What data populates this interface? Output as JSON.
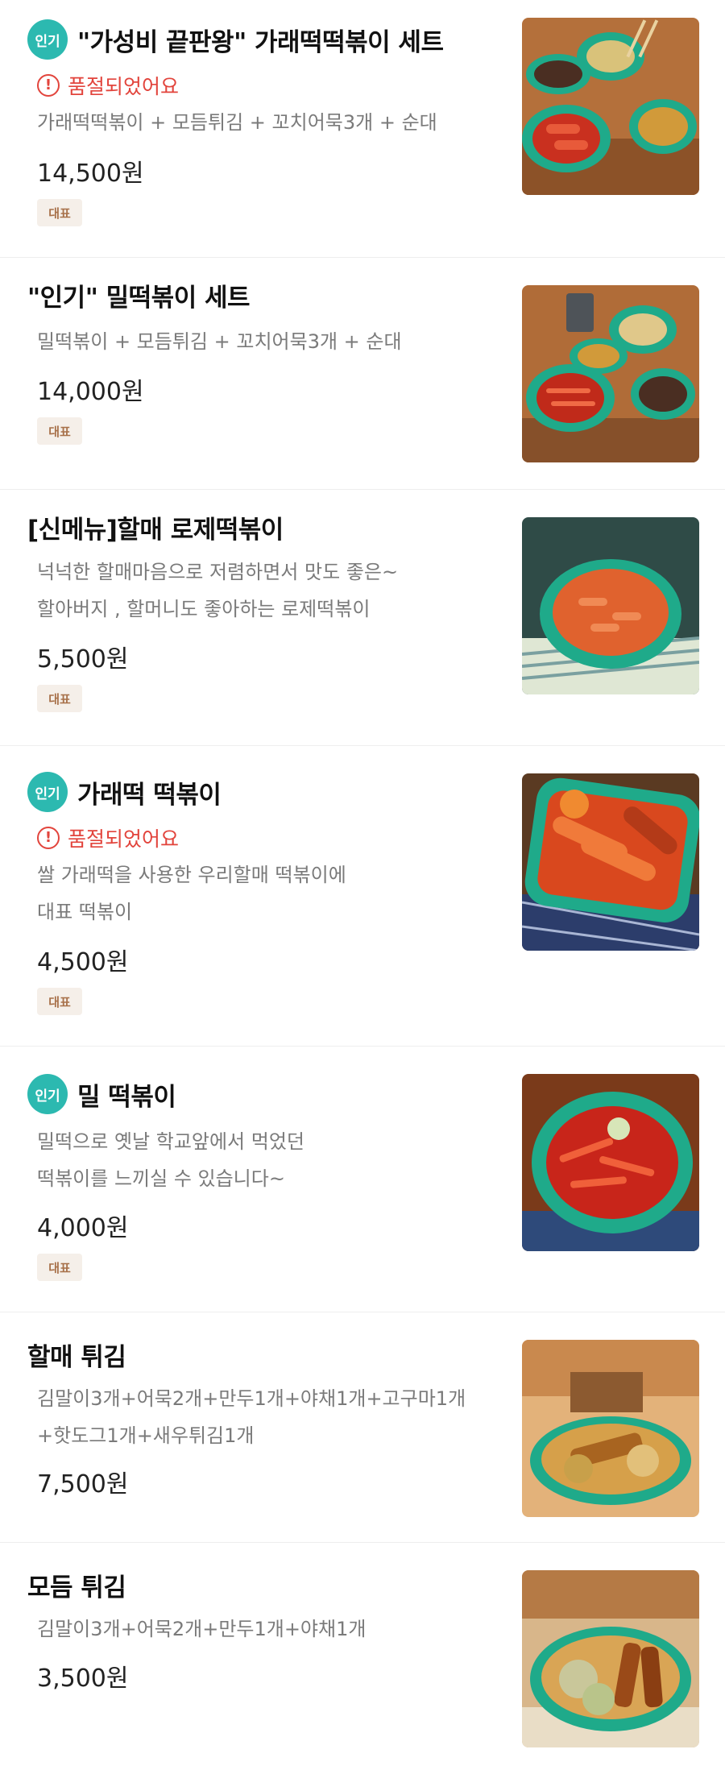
{
  "badges": {
    "popular": "인기",
    "representative": "대표"
  },
  "items": [
    {
      "name": "\"가성비 끝판왕\" 가래떡떡볶이 세트",
      "soldout": "품절되었어요",
      "desc": [
        "가래떡떡볶이 + 모듬튀김 + 꼬치어묵3개 + 순대"
      ],
      "price": "14,500원",
      "image_icon": "tteokbokki-set-photo"
    },
    {
      "name": "\"인기\" 밀떡볶이 세트",
      "desc": [
        "밀떡볶이 + 모듬튀김 + 꼬치어묵3개 + 순대"
      ],
      "price": "14,000원",
      "image_icon": "wheat-tteokbokki-set-photo"
    },
    {
      "name": "[신메뉴]할매 로제떡볶이",
      "desc": [
        "넉넉한 할매마음으로 저렴하면서 맛도 좋은~",
        "할아버지 , 할머니도 좋아하는 로제떡볶이"
      ],
      "price": "5,500원",
      "image_icon": "rose-tteokbokki-photo"
    },
    {
      "name": "가래떡 떡볶이",
      "soldout": "품절되었어요",
      "desc": [
        "쌀 가래떡을 사용한 우리할매 떡볶이에",
        "대표 떡볶이"
      ],
      "price": "4,500원",
      "image_icon": "rice-cake-tteokbokki-photo"
    },
    {
      "name": "밀 떡볶이",
      "desc": [
        "밀떡으로 옛날 학교앞에서 먹었던",
        "떡볶이를 느끼실 수 있습니다~"
      ],
      "price": "4,000원",
      "image_icon": "wheat-tteokbokki-photo"
    },
    {
      "name": "할매 튀김",
      "desc": [
        "김말이3개+어묵2개+만두1개+야채1개+고구마1개",
        "+핫도그1개+새우튀김1개"
      ],
      "price": "7,500원",
      "image_icon": "fried-platter-photo"
    },
    {
      "name": "모듬 튀김",
      "desc": [
        "김말이3개+어묵2개+만두1개+야채1개"
      ],
      "price": "3,500원",
      "image_icon": "assorted-fried-photo"
    }
  ],
  "colors": {
    "popular_badge": "#2cb9b0",
    "soldout": "#e2443c",
    "rep_badge_bg": "#f5efe9",
    "rep_badge_text": "#a8714a",
    "desc_text": "#7a7a7a",
    "bowl_green": "#1faa8a"
  }
}
